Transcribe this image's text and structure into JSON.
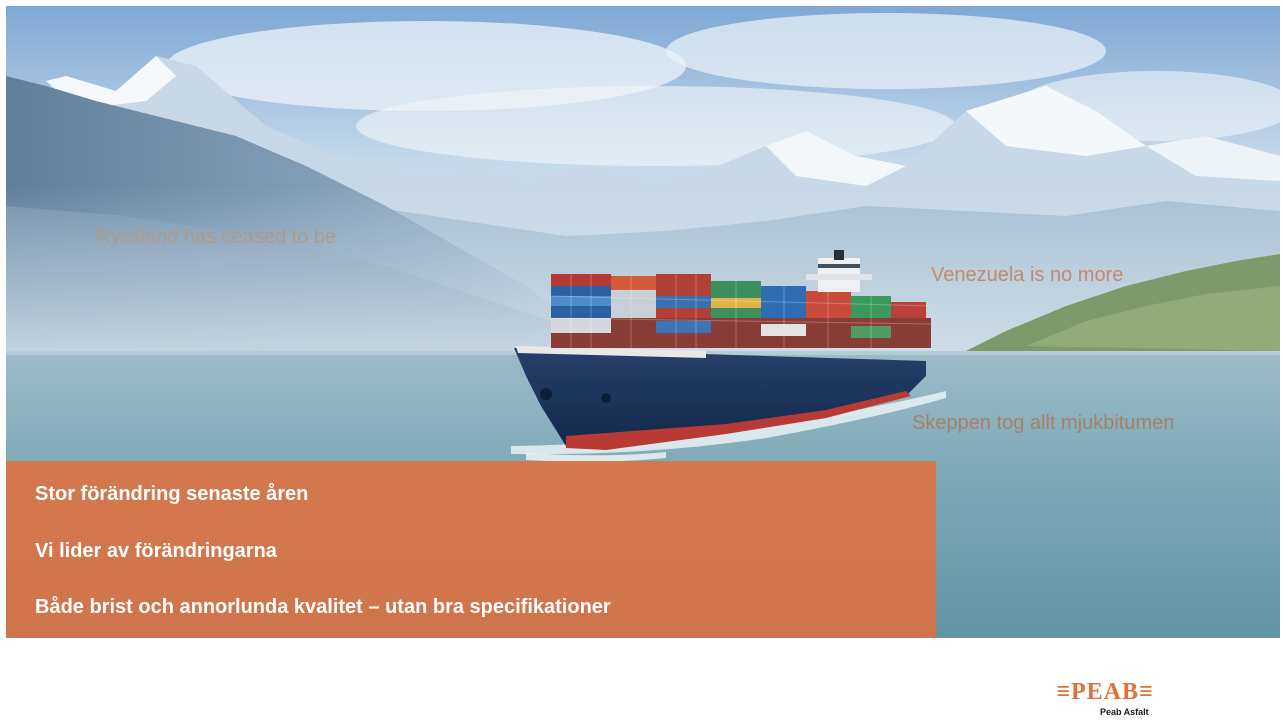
{
  "slide": {
    "overlay_texts": {
      "ryssland": "Ryssland has ceased to be",
      "venezuela": "Venezuela is no more",
      "skeppen": "Skeppen tog allt mjukbitumen"
    },
    "bullets": [
      "Stor förändring senaste åren",
      "Vi lider av förändringarna",
      "Både brist och annorlunda kvalitet – utan bra specifikationer"
    ],
    "logo": {
      "wordmark": "≡PEAB≡",
      "subtitle": "Peab Asfalt",
      "color": "#e36f3a"
    },
    "colors": {
      "orange_box": "#e36e3c",
      "sky": "#a9c3dc",
      "sea": "#6f9fb1",
      "hull": "#1d3660"
    }
  }
}
